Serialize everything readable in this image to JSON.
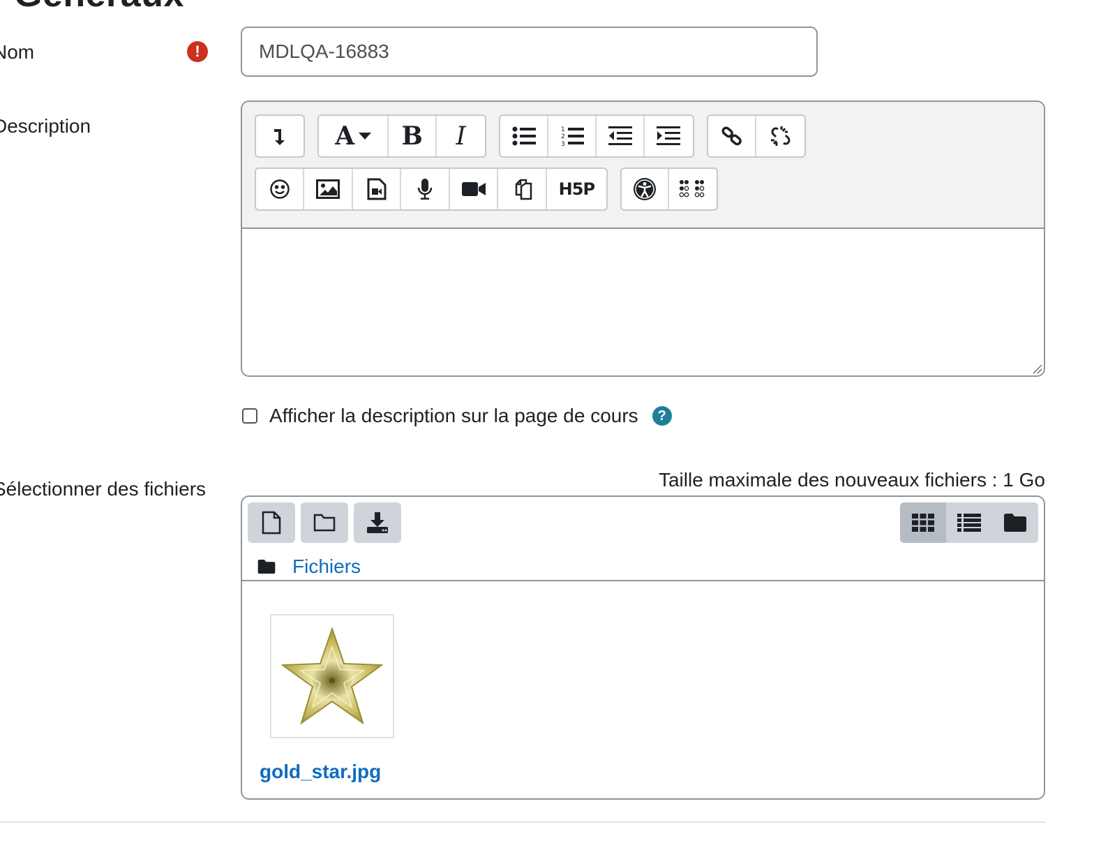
{
  "section": {
    "title": "Généraux"
  },
  "name_field": {
    "label": "Nom",
    "value": "MDLQA-16883"
  },
  "description": {
    "label": "Description"
  },
  "toolbar": {
    "row1": [
      "collapse-toolbar",
      "font-style",
      "bold",
      "italic",
      "unordered-list",
      "ordered-list",
      "outdent",
      "indent",
      "link",
      "unlink"
    ],
    "row2": [
      "emoji",
      "image",
      "media",
      "record-audio",
      "record-video",
      "manage-files",
      "h5p",
      "accessibility-checker",
      "screenreader-helper"
    ],
    "bold_glyph": "B",
    "italic_glyph": "I",
    "font_glyph": "A",
    "h5p_glyph": "H5P"
  },
  "show_description": {
    "label": "Afficher la description sur la page de cours",
    "checked": false,
    "help_glyph": "?"
  },
  "files": {
    "label": "Sélectionner des fichiers",
    "max_size": "Taille maximale des nouveaux fichiers : 1 Go",
    "path": "Fichiers",
    "items": [
      {
        "name": "gold_star.jpg"
      }
    ]
  },
  "colors": {
    "link": "#0f6cbf",
    "required": "#ca3120",
    "help": "#1f7e9a"
  }
}
